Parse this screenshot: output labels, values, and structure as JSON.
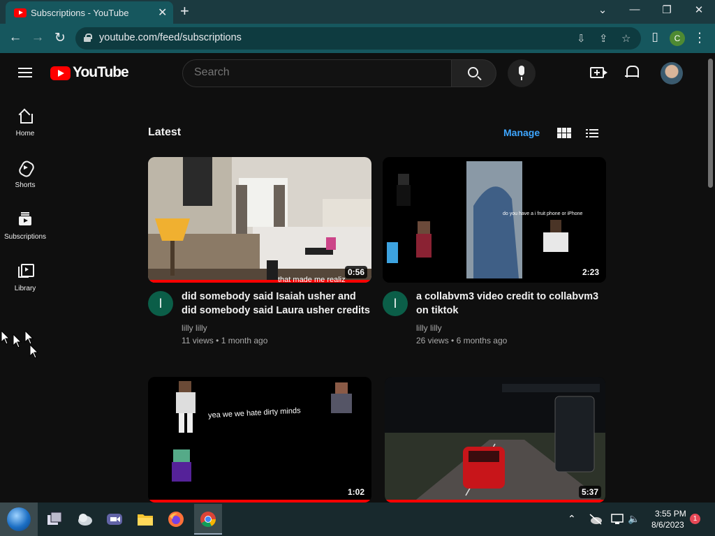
{
  "browser": {
    "tab_title": "Subscriptions - YouTube",
    "tab_close": "✕",
    "new_tab": "+",
    "url": "youtube.com/feed/subscriptions",
    "profile_initial": "C",
    "window_controls": {
      "minimize": "—",
      "restore": "❐",
      "close": "✕",
      "dropdown": "⌄"
    },
    "nav": {
      "back": "←",
      "forward": "→",
      "reload": "↻"
    },
    "omnibox_icons": {
      "install": "⇩",
      "share": "⇪",
      "bookmark": "☆",
      "sidepanel": "▯",
      "menu": "⋮"
    }
  },
  "youtube": {
    "logo_text": "YouTube",
    "search_placeholder": "Search",
    "sidebar": [
      {
        "label": "Home",
        "icon": "home-icon"
      },
      {
        "label": "Shorts",
        "icon": "shorts-icon"
      },
      {
        "label": "Subscriptions",
        "icon": "subscriptions-icon"
      },
      {
        "label": "Library",
        "icon": "library-icon"
      }
    ],
    "section_title": "Latest",
    "manage_label": "Manage",
    "videos": [
      {
        "title": "did somebody said Isaiah usher and did somebody said Laura usher credits is...",
        "channel": "lilly lilly",
        "channel_initial": "l",
        "views": "11 views",
        "age": "1 month ago",
        "duration": "0:56",
        "watched": 1.0,
        "thumb_caption": "that made me realiz"
      },
      {
        "title": "a collabvm3 video credit to collabvm3 on tiktok",
        "channel": "lilly lilly",
        "channel_initial": "l",
        "views": "26 views",
        "age": "6 months ago",
        "duration": "2:23",
        "watched": 0.0,
        "thumb_caption": "do you have a i fruit phone or iPhone"
      },
      {
        "title": "",
        "channel": "",
        "channel_initial": "",
        "views": "",
        "age": "",
        "duration": "1:02",
        "watched": 1.0,
        "thumb_caption": "yea we we hate dirty minds"
      },
      {
        "title": "",
        "channel": "",
        "channel_initial": "",
        "views": "",
        "age": "",
        "duration": "5:37",
        "watched": 1.0,
        "thumb_caption": ""
      }
    ],
    "meta_separator": "•"
  },
  "taskbar": {
    "time": "3:55 PM",
    "date": "8/6/2023",
    "notification_count": "1",
    "apps": [
      "task-view-icon",
      "weather-icon",
      "teams-icon",
      "file-explorer-icon",
      "firefox-icon",
      "chrome-icon"
    ]
  },
  "colors": {
    "youtube_red": "#ff0000",
    "link_blue": "#3ea6ff",
    "chrome_frame": "#16575e"
  }
}
